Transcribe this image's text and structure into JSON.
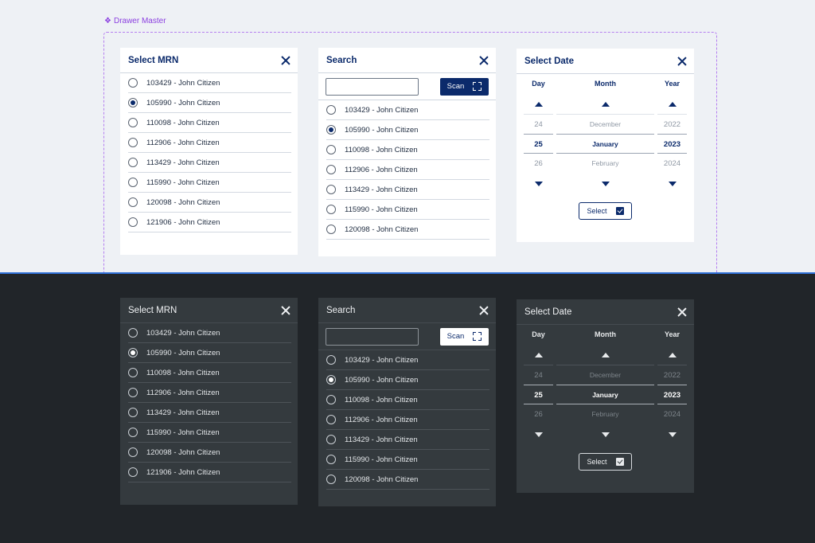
{
  "frame": {
    "label": "Drawer Master"
  },
  "mrn": {
    "title": "Select MRN",
    "items": [
      "103429 - John Citizen",
      "105990 - John Citizen",
      "110098 - John Citizen",
      "112906 - John Citizen",
      "113429 - John Citizen",
      "115990 - John Citizen",
      "120098 - John Citizen",
      "121906 - John Citizen"
    ],
    "selected_index": 1
  },
  "search": {
    "title": "Search",
    "placeholder": "",
    "scan_label": "Scan",
    "items": [
      "103429 - John Citizen",
      "105990 - John Citizen",
      "110098 - John Citizen",
      "112906 - John Citizen",
      "113429 - John Citizen",
      "115990 - John Citizen",
      "120098 - John Citizen"
    ],
    "selected_index": 1
  },
  "date": {
    "title": "Select Date",
    "headers": {
      "day": "Day",
      "month": "Month",
      "year": "Year"
    },
    "day": {
      "prev": "24",
      "current": "25",
      "next": "26"
    },
    "month": {
      "prev": "December",
      "current": "January",
      "next": "February"
    },
    "year": {
      "prev": "2022",
      "current": "2023",
      "next": "2024"
    },
    "select_label": "Select"
  },
  "colors": {
    "navy": "#0b2a6b",
    "light_bg": "#eef1f5",
    "dark_bg": "#212529",
    "dark_card": "#343a3e",
    "frame_purple": "#8b3fe0",
    "divider_blue": "#2f6fd6"
  }
}
